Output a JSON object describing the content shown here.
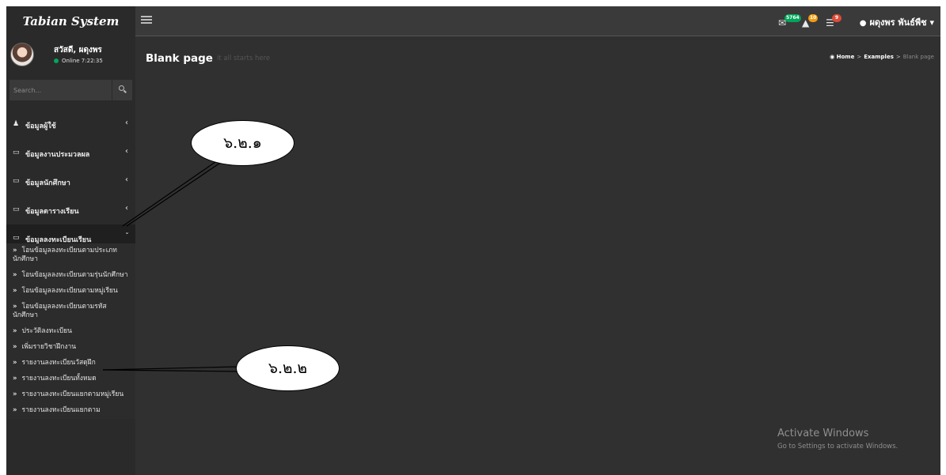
{
  "app": {
    "brand": "Tabian System"
  },
  "topbar": {
    "messages_badge": "5764",
    "alerts_badge": "10",
    "tasks_badge": "9",
    "user_label": "ผดุงพร พันธ์พืช",
    "badge_colors": {
      "messages": "#00a65a",
      "alerts": "#f39c12",
      "tasks": "#dd4b39"
    }
  },
  "sidebar": {
    "user_name": "สวัสดี, ผดุงพร",
    "status": "Online 7:22:35",
    "search_placeholder": "Search...",
    "menu": [
      {
        "label": "ข้อมูลผู้ใช้",
        "icon": "users-icon"
      },
      {
        "label": "ข้อมูลงานประมวลผล",
        "icon": "laptop-icon"
      },
      {
        "label": "ข้อมูลนักศึกษา",
        "icon": "laptop-icon"
      },
      {
        "label": "ข้อมูลตารางเรียน",
        "icon": "laptop-icon"
      },
      {
        "label": "ข้อมูลลงทะเบียนเรียน",
        "icon": "laptop-icon"
      }
    ],
    "submenu": [
      {
        "label": "โอนข้อมูลลงทะเบียนตามประเภทนักศึกษา"
      },
      {
        "label": "โอนข้อมูลลงทะเบียนตามรุ่นนักศึกษา"
      },
      {
        "label": "โอนข้อมูลลงทะเบียนตามหมู่เรียน"
      },
      {
        "label": "โอนข้อมูลลงทะเบียนตามรหัสนักศึกษา"
      },
      {
        "label": "ประวัติลงทะเบียน"
      },
      {
        "label": "เพิ่มรายวิชาฝึกงาน"
      },
      {
        "label": "รายงานลงทะเบียนวัสดุฝึก"
      },
      {
        "label": "รายงานลงทะเบียนทั้งหมด"
      },
      {
        "label": "รายงานลงทะเบียนแยกตามหมู่เรียน"
      },
      {
        "label": "รายงานลงทะเบียนแยกตาม"
      }
    ]
  },
  "content": {
    "title": "Blank page",
    "subtitle": "it all starts here",
    "breadcrumb": {
      "home": "Home",
      "examples": "Examples",
      "current": "Blank page"
    }
  },
  "watermark": {
    "line1": "Activate Windows",
    "line2": "Go to Settings to activate Windows."
  },
  "annotations": {
    "callout1": "๖.๒.๑",
    "callout2": "๖.๒.๒"
  }
}
